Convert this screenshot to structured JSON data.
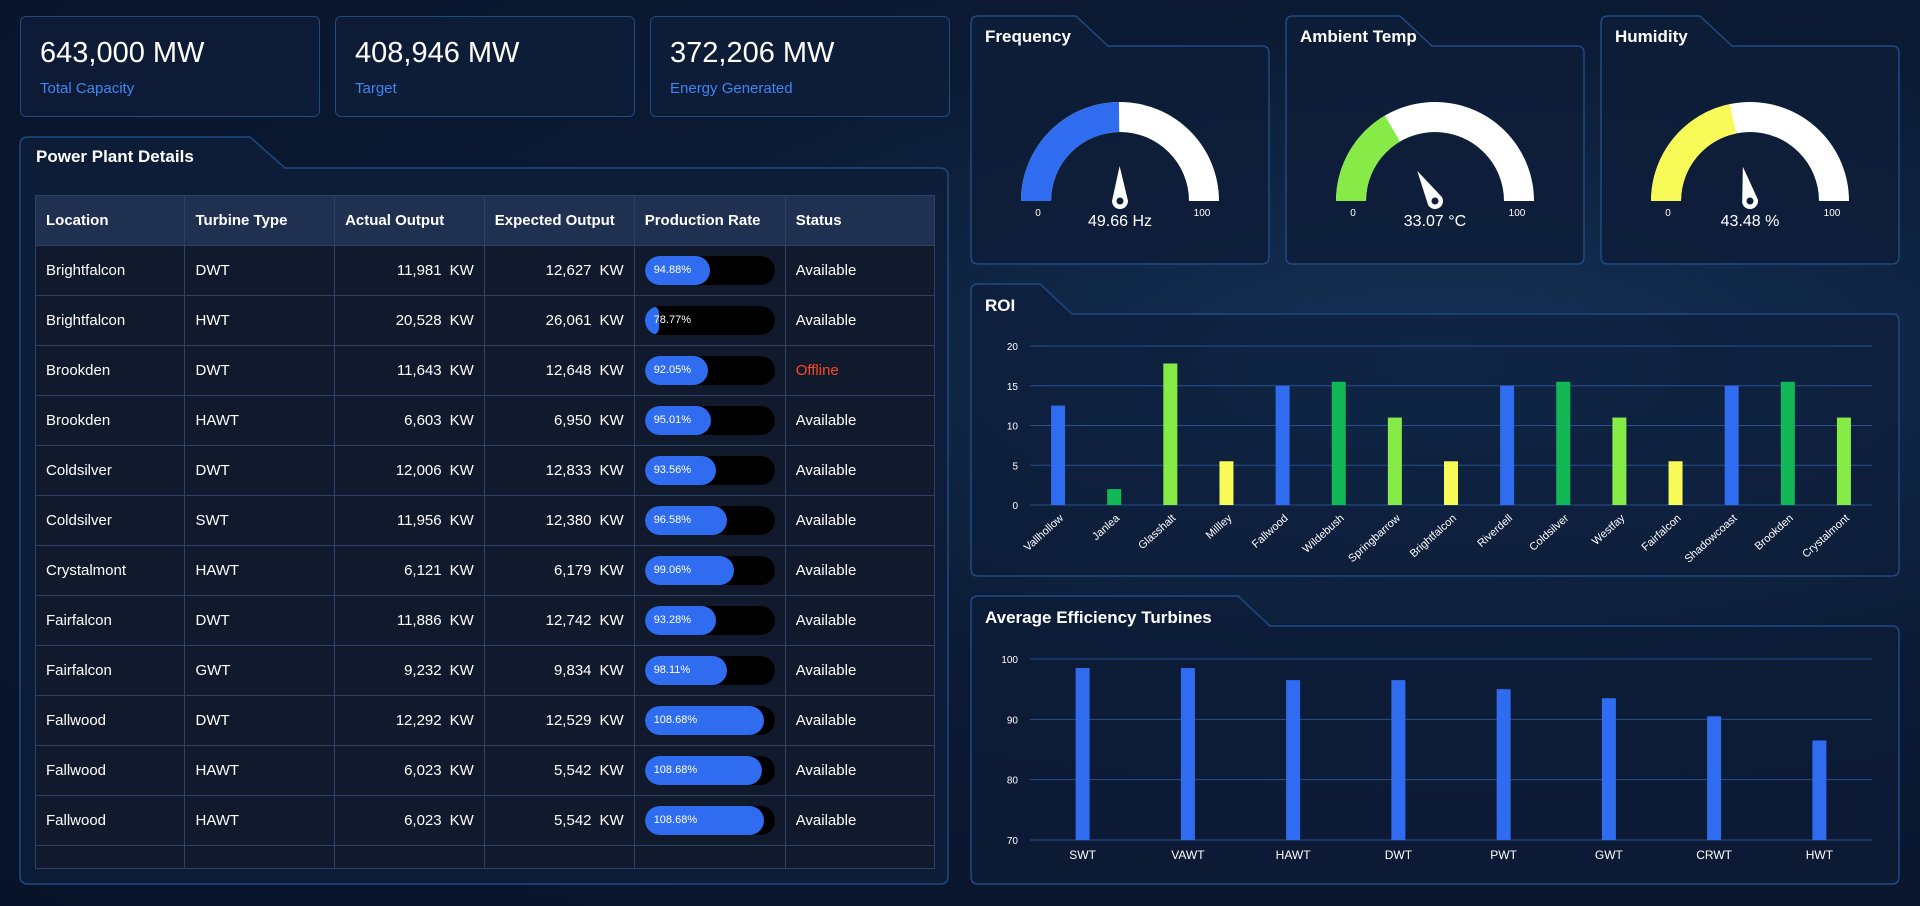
{
  "kpis": [
    {
      "value": "643,000 MW",
      "label": "Total Capacity"
    },
    {
      "value": "408,946 MW",
      "label": "Target"
    },
    {
      "value": "372,206 MW",
      "label": "Energy Generated"
    }
  ],
  "table": {
    "title": "Power Plant Details",
    "headers": [
      "Location",
      "Turbine Type",
      "Actual Output",
      "Expected Output",
      "Production Rate",
      "Status"
    ],
    "unit": "KW",
    "rows": [
      {
        "location": "Brightfalcon",
        "type": "DWT",
        "actual": "11,981",
        "expected": "12,627",
        "rate": "94.88%",
        "rate_fraction": 0.5,
        "status": "Available"
      },
      {
        "location": "Brightfalcon",
        "type": "HWT",
        "actual": "20,528",
        "expected": "26,061",
        "rate": "78.77%",
        "rate_fraction": 0.11,
        "status": "Available"
      },
      {
        "location": "Brookden",
        "type": "DWT",
        "actual": "11,643",
        "expected": "12,648",
        "rate": "92.05%",
        "rate_fraction": 0.49,
        "status": "Offline"
      },
      {
        "location": "Brookden",
        "type": "HAWT",
        "actual": "6,603",
        "expected": "6,950",
        "rate": "95.01%",
        "rate_fraction": 0.51,
        "status": "Available"
      },
      {
        "location": "Coldsilver",
        "type": "DWT",
        "actual": "12,006",
        "expected": "12,833",
        "rate": "93.56%",
        "rate_fraction": 0.55,
        "status": "Available"
      },
      {
        "location": "Coldsilver",
        "type": "SWT",
        "actual": "11,956",
        "expected": "12,380",
        "rate": "96.58%",
        "rate_fraction": 0.63,
        "status": "Available"
      },
      {
        "location": "Crystalmont",
        "type": "HAWT",
        "actual": "6,121",
        "expected": "6,179",
        "rate": "99.06%",
        "rate_fraction": 0.69,
        "status": "Available"
      },
      {
        "location": "Fairfalcon",
        "type": "DWT",
        "actual": "11,886",
        "expected": "12,742",
        "rate": "93.28%",
        "rate_fraction": 0.55,
        "status": "Available"
      },
      {
        "location": "Fairfalcon",
        "type": "GWT",
        "actual": "9,232",
        "expected": "9,834",
        "rate": "98.11%",
        "rate_fraction": 0.63,
        "status": "Available"
      },
      {
        "location": "Fallwood",
        "type": "DWT",
        "actual": "12,292",
        "expected": "12,529",
        "rate": "108.68%",
        "rate_fraction": 0.92,
        "status": "Available"
      },
      {
        "location": "Fallwood",
        "type": "HAWT",
        "actual": "6,023",
        "expected": "5,542",
        "rate": "108.68%",
        "rate_fraction": 0.9,
        "status": "Available"
      },
      {
        "location": "Fallwood",
        "type": "HAWT",
        "actual": "6,023",
        "expected": "5,542",
        "rate": "108.68%",
        "rate_fraction": 0.92,
        "status": "Available"
      }
    ]
  },
  "gauges": [
    {
      "title": "Frequency",
      "value": 49.66,
      "display": "49.66 Hz",
      "min": "0",
      "max": "100",
      "color": "#2f6cf0"
    },
    {
      "title": "Ambient Temp",
      "value": 33.07,
      "display": "33.07 °C",
      "min": "0",
      "max": "100",
      "color": "#86ea47"
    },
    {
      "title": "Humidity",
      "value": 43.48,
      "display": "43.48 %",
      "min": "0",
      "max": "100",
      "color": "#f7fa57"
    }
  ],
  "chart_data": [
    {
      "type": "bar",
      "title": "ROI",
      "categories": [
        "Vallhollow",
        "Janlea",
        "Glasshalt",
        "Millley",
        "Fallwood",
        "Wildebush",
        "Springbarrow",
        "Brightfalcon",
        "Riverdell",
        "Coldsilver",
        "Westfay",
        "Fairfalcon",
        "Shadowcoast",
        "Brookden",
        "Crystalmont"
      ],
      "values": [
        12.5,
        2,
        17.8,
        5.5,
        15,
        15.5,
        11,
        5.5,
        15,
        15.5,
        11,
        5.5,
        15,
        15.5,
        11
      ],
      "colors": [
        "#2f6cf0",
        "#13b856",
        "#86ea47",
        "#f7fa57",
        "#2f6cf0",
        "#13b856",
        "#86ea47",
        "#f7fa57",
        "#2f6cf0",
        "#13b856",
        "#86ea47",
        "#f7fa57",
        "#2f6cf0",
        "#13b856",
        "#86ea47"
      ],
      "ylim": [
        0,
        20
      ],
      "yticks": [
        "0",
        "5",
        "10",
        "15",
        "20"
      ],
      "grid": true
    },
    {
      "type": "bar",
      "title": "Average Efficiency Turbines",
      "categories": [
        "SWT",
        "VAWT",
        "HAWT",
        "DWT",
        "PWT",
        "GWT",
        "CRWT",
        "HWT"
      ],
      "values": [
        98.5,
        98.5,
        96.5,
        96.5,
        95,
        93.5,
        90.5,
        86.5
      ],
      "colors": [
        "#2f6cf0",
        "#2f6cf0",
        "#2f6cf0",
        "#2f6cf0",
        "#2f6cf0",
        "#2f6cf0",
        "#2f6cf0",
        "#2f6cf0"
      ],
      "ylim": [
        70,
        100
      ],
      "yticks": [
        "70",
        "80",
        "90",
        "100"
      ],
      "grid": true
    }
  ]
}
